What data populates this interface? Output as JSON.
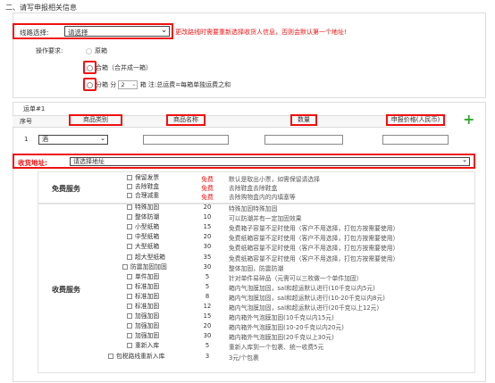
{
  "section_title": "二、请写申报相关信息",
  "route": {
    "label": "线路选择:",
    "selected": "请选择",
    "note": "更改路线时需要重新选择收货人信息，否则会默认第一个地址!"
  },
  "operation": {
    "label": "操作要求:",
    "options": [
      {
        "label": "原箱"
      },
      {
        "label": "合箱（合并成一箱）"
      },
      {
        "label_prefix": "分箱 分",
        "count": "2",
        "label_suffix": "箱 注:总运费=每箱单独运费之和"
      }
    ]
  },
  "order": {
    "title": "运单#1",
    "headers": {
      "num": "序号",
      "category": "商品类别",
      "name": "商品名称",
      "qty": "数量",
      "price": "申报价格(人民币)"
    },
    "row_num": "1",
    "category_selected": "酒",
    "address_label": "收货地址:",
    "address_selected": "请选择地址"
  },
  "free_services": {
    "title": "免费服务",
    "items": [
      {
        "name": "保留发票",
        "price": "免费",
        "desc": "默认是取出小票，如需保留请选择"
      },
      {
        "name": "去除鞋盒",
        "price": "免费",
        "desc": "去除鞋盒去除鞋盒"
      },
      {
        "name": "合理减重",
        "price": "免费",
        "desc": "去除购物盒内的内填塞等"
      }
    ]
  },
  "paid_services": {
    "title": "收费服务",
    "items": [
      {
        "name": "特殊加固",
        "price": "20",
        "desc": "特殊加固特殊加固"
      },
      {
        "name": "整体防潮",
        "price": "10",
        "desc": "可以防潮并有一定加固效果"
      },
      {
        "name": "小型纸箱",
        "price": "15",
        "desc": "免费箱子容量不足时使用（客户不用选择，打包方按需要使用）"
      },
      {
        "name": "中型纸箱",
        "price": "20",
        "desc": "免费纸箱容量不足时使用（客户不用选择，打包方按需要使用）"
      },
      {
        "name": "大型纸箱",
        "price": "30",
        "desc": "免费纸箱容量不足时使用（客户不用选择，打包方按需要使用）"
      },
      {
        "name": "超大型纸箱",
        "price": "35",
        "desc": "免费纸箱容量不足时使用（客户不用选择，打包方按需要使用）"
      },
      {
        "name": "防震加固加固",
        "price": "30",
        "desc": "整体加固，防震防潮"
      },
      {
        "name": "单件加固",
        "price": "5",
        "desc": "针对单件易碎品（元需可以三枚做一个单件加固）"
      },
      {
        "name": "标准加固",
        "price": "5",
        "desc": "箱内气泡膜加固，sal和超运默认进行(10千克以内5元)"
      },
      {
        "name": "标准加固",
        "price": "8",
        "desc": "箱内气泡膜加固，sal和超运默认进行(10-20千克以内8元)"
      },
      {
        "name": "标准加固",
        "price": "12",
        "desc": "箱内气泡膜加固，sal和超运默认进行(20千克以上12元)"
      },
      {
        "name": "加强加固",
        "price": "15",
        "desc": "箱内箱外气泡膜加固(10千克以内15元)"
      },
      {
        "name": "加强加固",
        "price": "20",
        "desc": "箱内箱外气泡膜加固(10-20千克以内20元)"
      },
      {
        "name": "加强加固",
        "price": "30",
        "desc": "箱内箱外气泡膜加固(20千克以上30元)"
      },
      {
        "name": "重新入库",
        "price": "5",
        "desc": "重新入库到一个包裹、统一收费5元"
      },
      {
        "name": "包税路线重新入库",
        "price": "3",
        "desc": "3元/个包裹"
      }
    ]
  }
}
